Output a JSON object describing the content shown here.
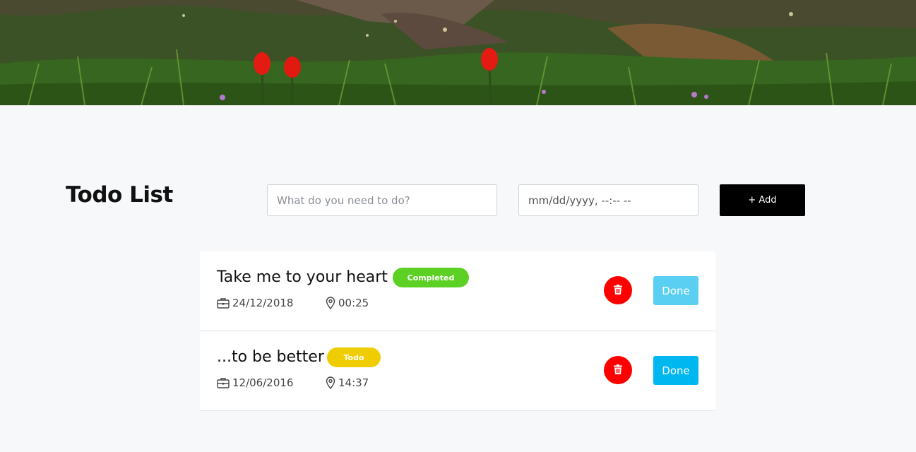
{
  "page": {
    "title": "Todo List"
  },
  "form": {
    "task_placeholder": "What do you need to do?",
    "date_placeholder": "mm/dd/yyyy, --:-- --",
    "add_label": "+ Add"
  },
  "todos": [
    {
      "title": "Take me to your heart",
      "status": "Completed",
      "status_color": "#5cd023",
      "date": "24/12/2018",
      "time": "00:25",
      "done_label": "Done",
      "done_color": "#5bcff2"
    },
    {
      "title": "...to be better",
      "status": "Todo",
      "status_color": "#f0cd00",
      "date": "12/06/2016",
      "time": "14:37",
      "done_label": "Done",
      "done_color": "#00b7ef"
    }
  ],
  "icons": {
    "date": "briefcase-icon",
    "time": "map-pin-icon",
    "delete": "trash-icon"
  },
  "colors": {
    "delete": "#ff0000",
    "add": "#000000",
    "background": "#f7f8fa"
  }
}
